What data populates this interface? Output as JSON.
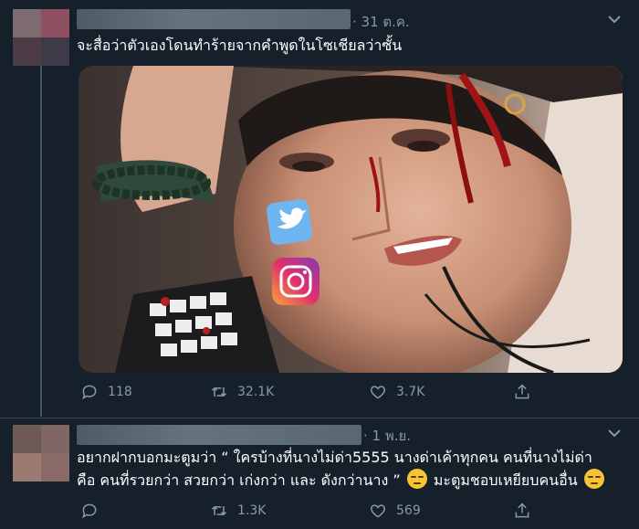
{
  "tweets": [
    {
      "date": "· 31 ต.ค.",
      "text": "จะสื่อว่าตัวเองโดนทำร้ายจากคำพูดในโซเชียลว่าซั้น",
      "media": {
        "subject": "bloodied-face-with-social-icons"
      },
      "actions": {
        "replies": "118",
        "retweets": "32.1K",
        "likes": "3.7K"
      }
    },
    {
      "date": "· 1 พ.ย.",
      "text_line1": "อยากฝากบอกมะตูมว่า “ ใครบ้างที่นางไม่ด่า5555 นางด่าเค้าทุกคน คนที่นางไม่ด่า",
      "text_line2a": "คือ คนที่รวยกว่า สวยกว่า เก่งกว่า และ ดังกว่านาง ”",
      "text_line2b": "มะตูมชอบเหยียบคนอื่น",
      "actions": {
        "retweets": "1.3K",
        "likes": "569"
      }
    }
  ],
  "icons": [
    "reply-icon",
    "retweet-icon",
    "like-icon",
    "share-icon",
    "caret-down-icon",
    "unamused-emoji-icon"
  ],
  "colors": {
    "background": "#15202b",
    "muted": "#8899a6",
    "divider": "#38444d"
  }
}
